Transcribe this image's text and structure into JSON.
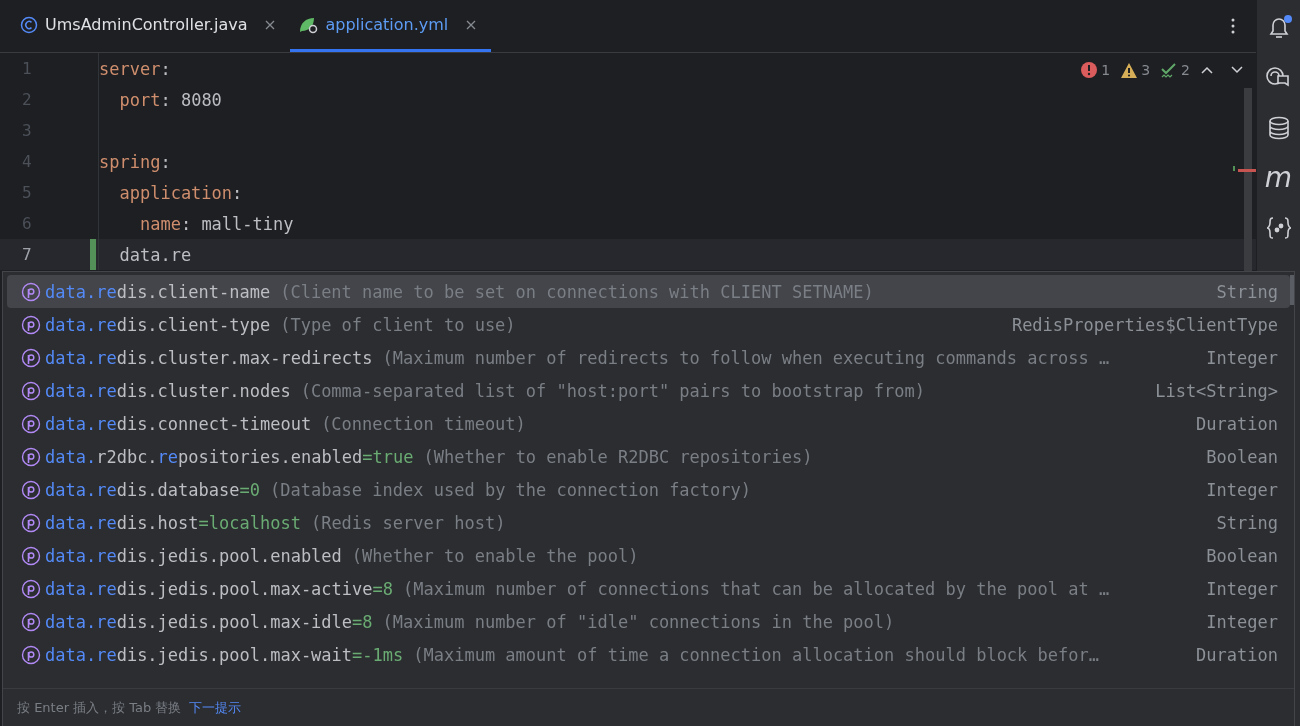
{
  "tabs": [
    {
      "label": "UmsAdminController.java",
      "kind": "class",
      "selected": false
    },
    {
      "label": "application.yml",
      "kind": "spring",
      "selected": true
    }
  ],
  "editor": {
    "lines": [
      {
        "number": "1",
        "current": false,
        "changed": false,
        "tokens": [
          {
            "text": "server",
            "kind": "key"
          },
          {
            "text": ":",
            "kind": "punct"
          }
        ]
      },
      {
        "number": "2",
        "current": false,
        "changed": false,
        "tokens": [
          {
            "text": "  port",
            "kind": "key"
          },
          {
            "text": ":",
            "kind": "punct"
          },
          {
            "text": " 8080",
            "kind": "value"
          }
        ]
      },
      {
        "number": "3",
        "current": false,
        "changed": false
      },
      {
        "number": "4",
        "current": false,
        "changed": false,
        "tokens": [
          {
            "text": "spring",
            "kind": "key"
          },
          {
            "text": ":",
            "kind": "punct"
          }
        ]
      },
      {
        "number": "5",
        "current": false,
        "changed": false,
        "tokens": [
          {
            "text": "  application",
            "kind": "key"
          },
          {
            "text": ":",
            "kind": "punct"
          }
        ]
      },
      {
        "number": "6",
        "current": false,
        "changed": false,
        "tokens": [
          {
            "text": "    name",
            "kind": "key"
          },
          {
            "text": ":",
            "kind": "punct"
          },
          {
            "text": " mall-tiny",
            "kind": "value"
          }
        ]
      },
      {
        "number": "7",
        "current": true,
        "changed": true,
        "tokens": [
          {
            "text": "  data.re",
            "kind": "value"
          }
        ]
      }
    ],
    "inspections": {
      "errors": "1",
      "warnings": "3",
      "typos": "2"
    }
  },
  "completion": {
    "items": [
      {
        "selected": true,
        "name": [
          {
            "text": "data.re",
            "match": true
          },
          {
            "text": "dis.client-name",
            "match": false
          }
        ],
        "description": "(Client name to be set on connections with CLIENT SETNAME)",
        "type": "String"
      },
      {
        "selected": false,
        "name": [
          {
            "text": "data.re",
            "match": true
          },
          {
            "text": "dis.client-type",
            "match": false
          }
        ],
        "description": "(Type of client to use)",
        "type": "RedisProperties$ClientType"
      },
      {
        "selected": false,
        "name": [
          {
            "text": "data.re",
            "match": true
          },
          {
            "text": "dis.cluster.max-redirects",
            "match": false
          }
        ],
        "description": "(Maximum number of redirects to follow when executing commands across …",
        "type": "Integer"
      },
      {
        "selected": false,
        "name": [
          {
            "text": "data.re",
            "match": true
          },
          {
            "text": "dis.cluster.nodes",
            "match": false
          }
        ],
        "description": "(Comma-separated list of \"host:port\" pairs to bootstrap from)",
        "type": "List<String>"
      },
      {
        "selected": false,
        "name": [
          {
            "text": "data.re",
            "match": true
          },
          {
            "text": "dis.connect-timeout",
            "match": false
          }
        ],
        "description": "(Connection timeout)",
        "type": "Duration"
      },
      {
        "selected": false,
        "name": [
          {
            "text": "data.",
            "match": true
          },
          {
            "text": "r2dbc.",
            "match": false
          },
          {
            "text": "re",
            "match": true
          },
          {
            "text": "positories.enabled",
            "match": false
          }
        ],
        "default": "=true",
        "description": "(Whether to enable R2DBC repositories)",
        "type": "Boolean"
      },
      {
        "selected": false,
        "name": [
          {
            "text": "data.re",
            "match": true
          },
          {
            "text": "dis.database",
            "match": false
          }
        ],
        "default": "=0",
        "description": "(Database index used by the connection factory)",
        "type": "Integer"
      },
      {
        "selected": false,
        "name": [
          {
            "text": "data.re",
            "match": true
          },
          {
            "text": "dis.host",
            "match": false
          }
        ],
        "default": "=localhost",
        "description": "(Redis server host)",
        "type": "String"
      },
      {
        "selected": false,
        "name": [
          {
            "text": "data.re",
            "match": true
          },
          {
            "text": "dis.jedis.pool.enabled",
            "match": false
          }
        ],
        "description": "(Whether to enable the pool)",
        "type": "Boolean"
      },
      {
        "selected": false,
        "name": [
          {
            "text": "data.re",
            "match": true
          },
          {
            "text": "dis.jedis.pool.max-active",
            "match": false
          }
        ],
        "default": "=8",
        "description": "(Maximum number of connections that can be allocated by the pool at …",
        "type": "Integer"
      },
      {
        "selected": false,
        "name": [
          {
            "text": "data.re",
            "match": true
          },
          {
            "text": "dis.jedis.pool.max-idle",
            "match": false
          }
        ],
        "default": "=8",
        "description": "(Maximum number of \"idle\" connections in the pool)",
        "type": "Integer"
      },
      {
        "selected": false,
        "name": [
          {
            "text": "data.re",
            "match": true
          },
          {
            "text": "dis.jedis.pool.max-wait",
            "match": false
          }
        ],
        "default": "=-1ms",
        "description": "(Maximum amount of time a connection allocation should block befor…",
        "type": "Duration"
      }
    ],
    "footer": {
      "hint": "按 Enter 插入，按 Tab 替换",
      "link": "下一提示"
    }
  },
  "tool_sidebar": [
    {
      "kind": "bell",
      "badge": true
    },
    {
      "kind": "chat",
      "badge": false
    },
    {
      "kind": "database",
      "badge": false
    },
    {
      "kind": "maven",
      "glyph": "m",
      "badge": false
    },
    {
      "kind": "braces",
      "badge": false
    }
  ]
}
